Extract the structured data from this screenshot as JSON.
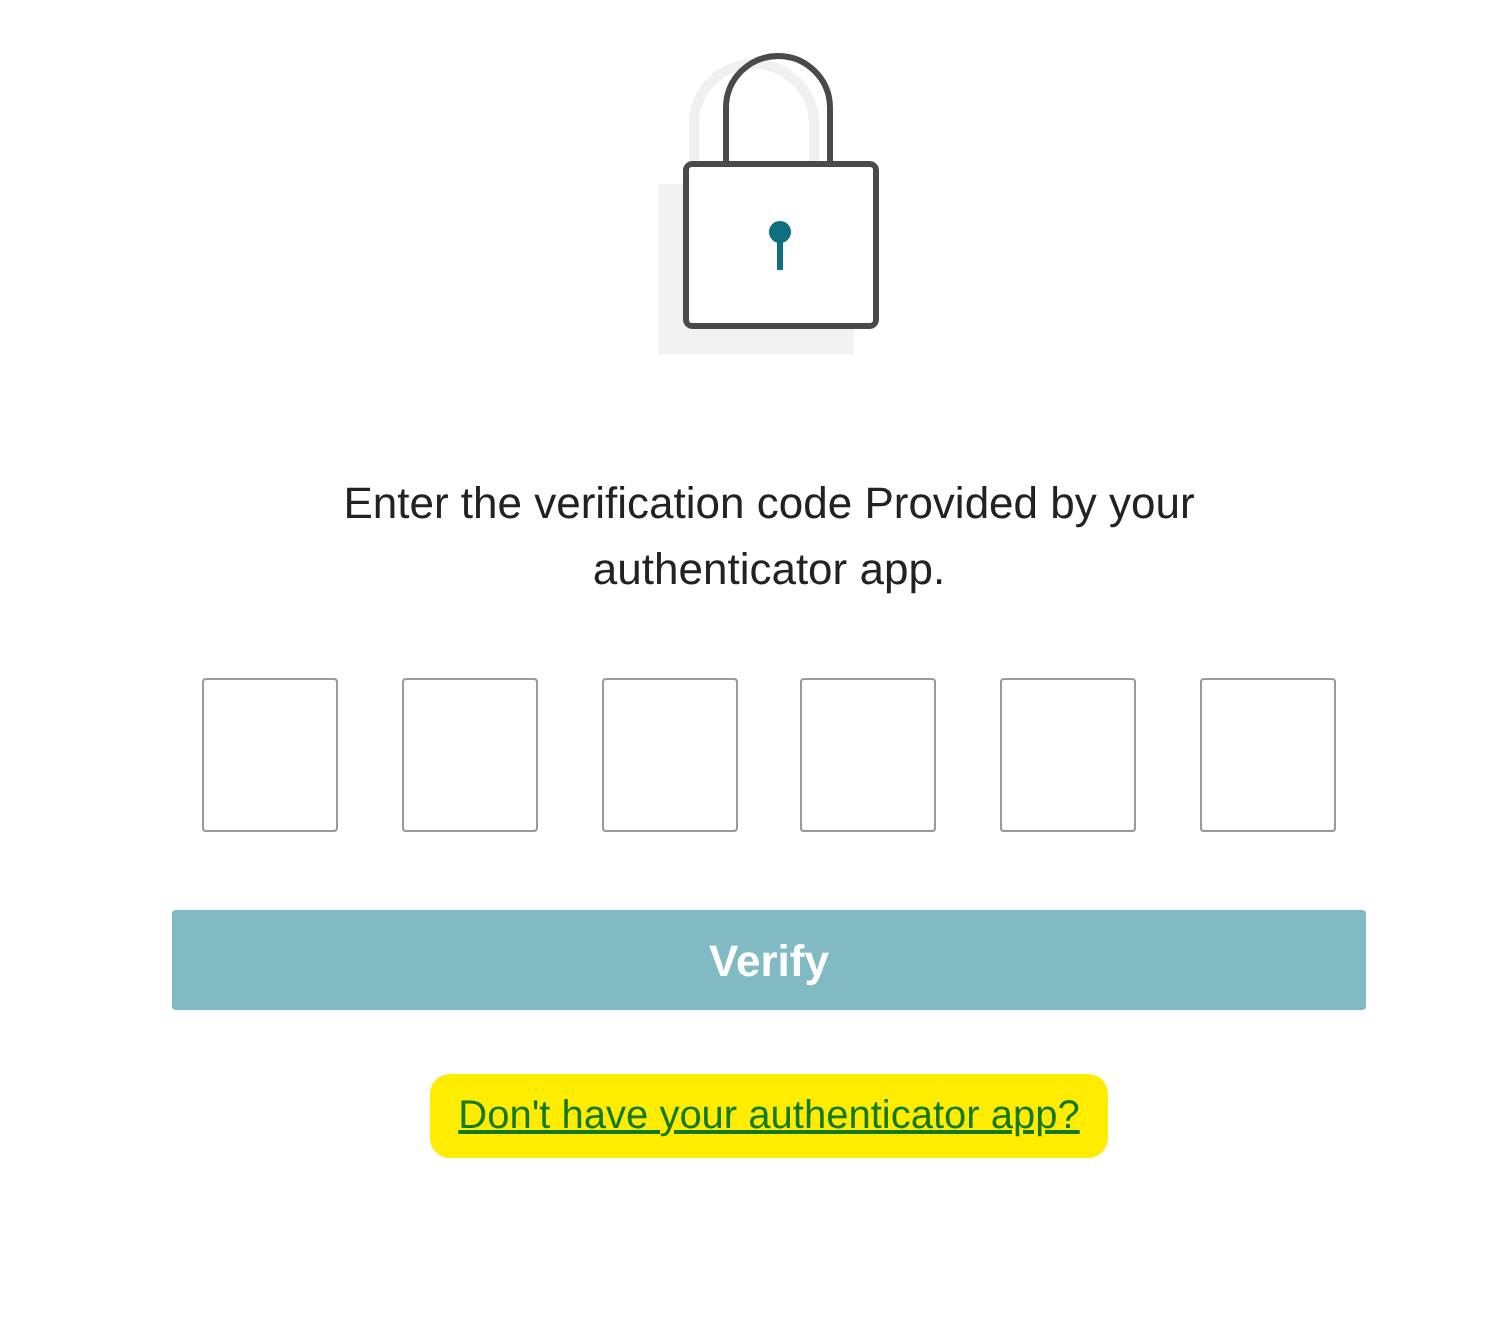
{
  "prompt": "Enter the verification code Provided by your authenticator app.",
  "code_fields": [
    {
      "kind": "digit"
    },
    {
      "kind": "digit"
    },
    {
      "kind": "digit"
    },
    {
      "kind": "digit"
    },
    {
      "kind": "digit"
    },
    {
      "kind": "digit"
    }
  ],
  "verify_button": {
    "label": "Verify",
    "disabled": true
  },
  "help_link": {
    "text": "Don't have your authenticator app?",
    "highlighted": true
  }
}
